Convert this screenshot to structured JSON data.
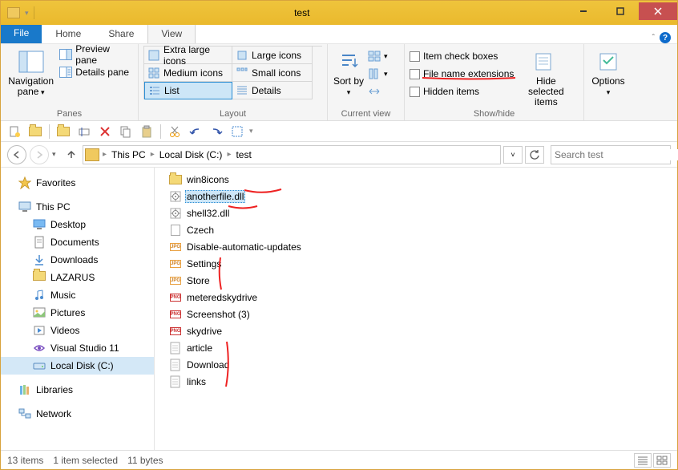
{
  "window": {
    "title": "test"
  },
  "tabs": {
    "file": "File",
    "home": "Home",
    "share": "Share",
    "view": "View",
    "active": "view"
  },
  "ribbon": {
    "panes": {
      "nav": "Navigation pane",
      "preview": "Preview pane",
      "details": "Details pane",
      "group": "Panes"
    },
    "layout": {
      "xlarge": "Extra large icons",
      "large": "Large icons",
      "medium": "Medium icons",
      "small": "Small icons",
      "list": "List",
      "details": "Details",
      "group": "Layout"
    },
    "current": {
      "sortby": "Sort by",
      "group": "Current view"
    },
    "showhide": {
      "checkboxes": "Item check boxes",
      "extensions": "File name extensions",
      "hidden": "Hidden items",
      "hideselected": "Hide selected items",
      "group": "Show/hide"
    },
    "options": {
      "label": "Options"
    }
  },
  "breadcrumbs": [
    "This PC",
    "Local Disk (C:)",
    "test"
  ],
  "search_placeholder": "Search test",
  "nav": {
    "favorites": "Favorites",
    "thispc": "This PC",
    "thispc_children": [
      "Desktop",
      "Documents",
      "Downloads",
      "LAZARUS",
      "Music",
      "Pictures",
      "Videos",
      "Visual Studio 11",
      "Local Disk (C:)"
    ],
    "libraries": "Libraries",
    "network": "Network"
  },
  "files": [
    {
      "name": "win8icons",
      "type": "folder"
    },
    {
      "name": "anotherfile.dll",
      "type": "dll",
      "selected": true
    },
    {
      "name": "shell32.dll",
      "type": "dll"
    },
    {
      "name": "Czech",
      "type": "file"
    },
    {
      "name": "Disable-automatic-updates",
      "type": "jpg"
    },
    {
      "name": "Settings",
      "type": "jpg"
    },
    {
      "name": "Store",
      "type": "jpg"
    },
    {
      "name": "meteredskydrive",
      "type": "png"
    },
    {
      "name": "Screenshot (3)",
      "type": "png"
    },
    {
      "name": "skydrive",
      "type": "png"
    },
    {
      "name": "article",
      "type": "txt"
    },
    {
      "name": "Download",
      "type": "txt"
    },
    {
      "name": "links",
      "type": "txt"
    }
  ],
  "status": {
    "count": "13 items",
    "selected": "1 item selected",
    "size": "11 bytes"
  }
}
